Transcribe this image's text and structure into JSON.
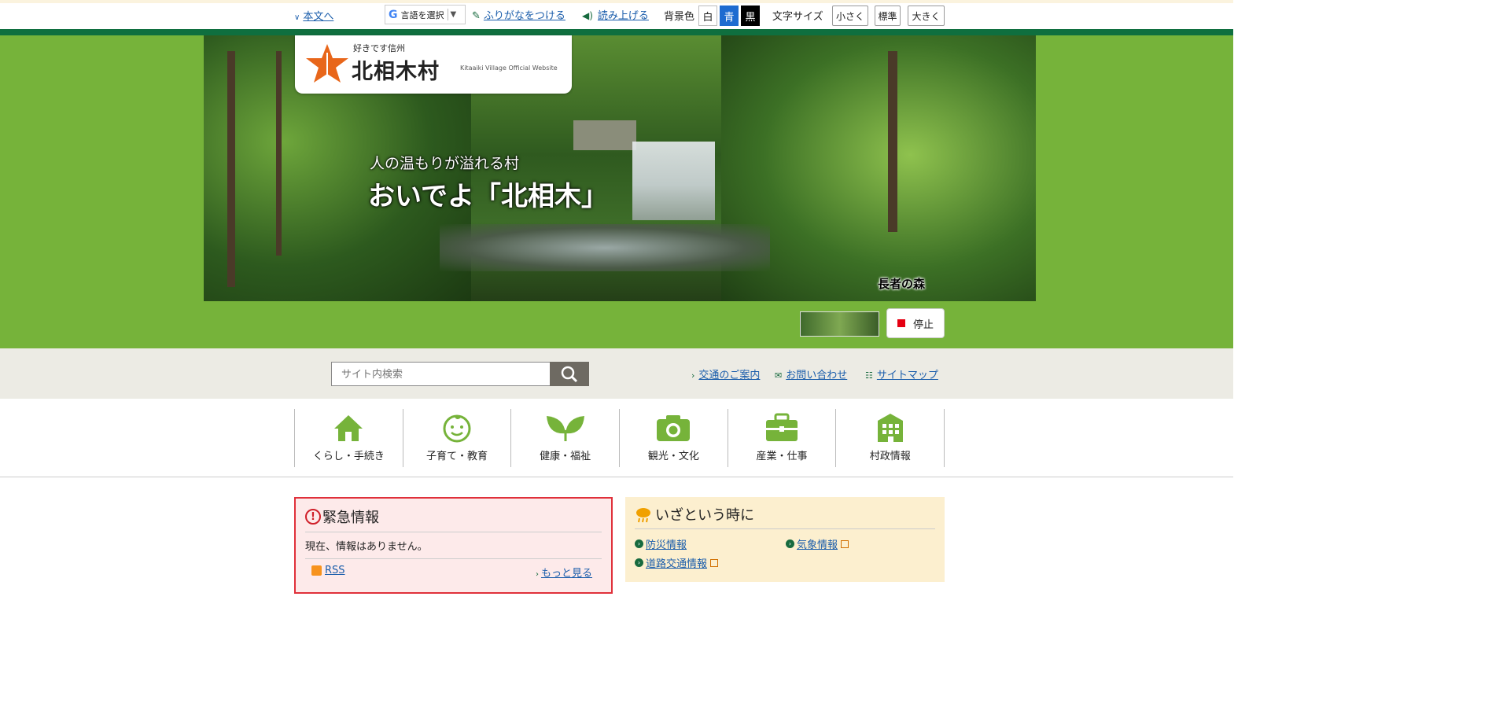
{
  "utility": {
    "skip_link": "本文へ",
    "language": "言語を選択",
    "furigana": "ふりがなをつける",
    "read_aloud": "読み上げる",
    "bg_color_label": "背景色",
    "bg_white": "白",
    "bg_blue": "青",
    "bg_black": "黒",
    "font_size_label": "文字サイズ",
    "font_small": "小さく",
    "font_standard": "標準",
    "font_large": "大きく"
  },
  "logo": {
    "tagline": "好きです信州",
    "name": "北相木村",
    "english": "Kitaaiki Village Official Website"
  },
  "hero": {
    "subtitle": "人の温もりが溢れる村",
    "title": "おいでよ「北相木」",
    "caption": "長者の森",
    "stop_button": "停止"
  },
  "search": {
    "placeholder": "サイト内検索"
  },
  "header_links": {
    "access": "交通のご案内",
    "contact": "お問い合わせ",
    "sitemap": "サイトマップ"
  },
  "global_nav": [
    {
      "label": "くらし・手続き",
      "icon": "house-icon"
    },
    {
      "label": "子育て・教育",
      "icon": "baby-face-icon"
    },
    {
      "label": "健康・福祉",
      "icon": "sprout-icon"
    },
    {
      "label": "観光・文化",
      "icon": "camera-icon"
    },
    {
      "label": "産業・仕事",
      "icon": "briefcase-icon"
    },
    {
      "label": "村政情報",
      "icon": "building-icon"
    }
  ],
  "emergency": {
    "title": "緊急情報",
    "body": "現在、情報はありません。",
    "rss": "RSS",
    "more": "もっと見る"
  },
  "disaster": {
    "title": "いざという時に",
    "links": [
      "防災情報",
      "気象情報",
      "道路交通情報"
    ]
  },
  "colors": {
    "brand_green": "#76b33a",
    "dark_green": "#0f6f3f",
    "link_blue": "#1a5dab",
    "emergency_red": "#e0303a",
    "disaster_bg": "#fcefcf"
  }
}
